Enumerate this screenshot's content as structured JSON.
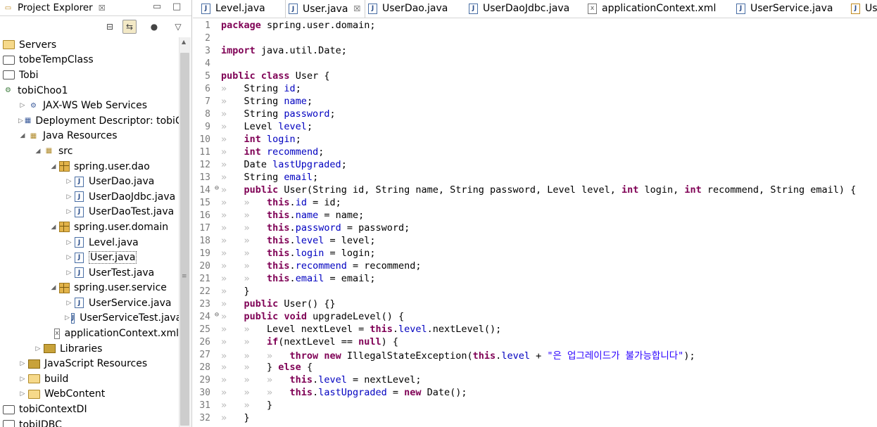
{
  "explorer": {
    "title": "Project Explorer",
    "close_glyph": "☒",
    "minimize_glyph": "▭",
    "maximize_glyph": "□",
    "view_menu_glyph": "▽",
    "items": [
      {
        "depth": 0,
        "twisty": "",
        "icon": "folder-open",
        "label": "Servers"
      },
      {
        "depth": 0,
        "twisty": "",
        "icon": "project",
        "label": "tobeTempClass"
      },
      {
        "depth": 0,
        "twisty": "",
        "icon": "project",
        "label": "Tobi"
      },
      {
        "depth": 0,
        "twisty": "",
        "icon": "web-project",
        "label": "tobiChoo1"
      },
      {
        "depth": 1,
        "twisty": "▷",
        "icon": "web-services",
        "label": "JAX-WS Web Services"
      },
      {
        "depth": 1,
        "twisty": "▷",
        "icon": "descriptor",
        "label": "Deployment Descriptor: tobiCh"
      },
      {
        "depth": 1,
        "twisty": "◢",
        "icon": "java-resources",
        "label": "Java Resources"
      },
      {
        "depth": 2,
        "twisty": "◢",
        "icon": "src-folder",
        "label": "src"
      },
      {
        "depth": 3,
        "twisty": "◢",
        "icon": "package",
        "label": "spring.user.dao"
      },
      {
        "depth": 4,
        "twisty": "▷",
        "icon": "java",
        "label": "UserDao.java"
      },
      {
        "depth": 4,
        "twisty": "▷",
        "icon": "java",
        "label": "UserDaoJdbc.java"
      },
      {
        "depth": 4,
        "twisty": "▷",
        "icon": "java",
        "label": "UserDaoTest.java"
      },
      {
        "depth": 3,
        "twisty": "◢",
        "icon": "package",
        "label": "spring.user.domain"
      },
      {
        "depth": 4,
        "twisty": "▷",
        "icon": "java",
        "label": "Level.java"
      },
      {
        "depth": 4,
        "twisty": "▷",
        "icon": "java",
        "label": "User.java",
        "selected": true
      },
      {
        "depth": 4,
        "twisty": "▷",
        "icon": "java",
        "label": "UserTest.java"
      },
      {
        "depth": 3,
        "twisty": "◢",
        "icon": "package",
        "label": "spring.user.service"
      },
      {
        "depth": 4,
        "twisty": "▷",
        "icon": "java",
        "label": "UserService.java"
      },
      {
        "depth": 4,
        "twisty": "▷",
        "icon": "java",
        "label": "UserServiceTest.java"
      },
      {
        "depth": 3,
        "twisty": "",
        "icon": "xml",
        "label": "applicationContext.xml"
      },
      {
        "depth": 2,
        "twisty": "▷",
        "icon": "library",
        "label": "Libraries"
      },
      {
        "depth": 1,
        "twisty": "▷",
        "icon": "library",
        "label": "JavaScript Resources"
      },
      {
        "depth": 1,
        "twisty": "▷",
        "icon": "folder-open",
        "label": "build"
      },
      {
        "depth": 1,
        "twisty": "▷",
        "icon": "folder-open",
        "label": "WebContent"
      },
      {
        "depth": 0,
        "twisty": "",
        "icon": "project",
        "label": "tobiContextDI"
      },
      {
        "depth": 0,
        "twisty": "",
        "icon": "project",
        "label": "tobiJDBC"
      }
    ]
  },
  "editor": {
    "tabs": [
      {
        "label": "Level.java",
        "icon": "java"
      },
      {
        "label": "User.java",
        "icon": "java",
        "active": true,
        "close": "☒"
      },
      {
        "label": "UserDao.java",
        "icon": "java"
      },
      {
        "label": "UserDaoJdbc.java",
        "icon": "java"
      },
      {
        "label": "applicationContext.xml",
        "icon": "xml"
      },
      {
        "label": "UserService.java",
        "icon": "java"
      },
      {
        "label": "Us",
        "icon": "java-warn"
      }
    ],
    "lines": [
      {
        "n": "1",
        "t": [
          [
            "kw",
            "package"
          ],
          [
            "src",
            " spring.user.domain;"
          ]
        ]
      },
      {
        "n": "2",
        "t": []
      },
      {
        "n": "3",
        "t": [
          [
            "kw",
            "import"
          ],
          [
            "src",
            " java.util.Date;"
          ]
        ]
      },
      {
        "n": "4",
        "t": []
      },
      {
        "n": "5",
        "t": [
          [
            "kw",
            "public"
          ],
          [
            "src",
            " "
          ],
          [
            "kw",
            "class"
          ],
          [
            "src",
            " User {"
          ]
        ]
      },
      {
        "n": "6",
        "t": [
          [
            "ws",
            "»   "
          ],
          [
            "src",
            "String "
          ],
          [
            "fld",
            "id"
          ],
          [
            "src",
            ";"
          ]
        ]
      },
      {
        "n": "7",
        "t": [
          [
            "ws",
            "»   "
          ],
          [
            "src",
            "String "
          ],
          [
            "fld",
            "name"
          ],
          [
            "src",
            ";"
          ]
        ]
      },
      {
        "n": "8",
        "t": [
          [
            "ws",
            "»   "
          ],
          [
            "src",
            "String "
          ],
          [
            "fld",
            "password"
          ],
          [
            "src",
            ";"
          ]
        ]
      },
      {
        "n": "9",
        "t": [
          [
            "ws",
            "»   "
          ],
          [
            "src",
            "Level "
          ],
          [
            "fld",
            "level"
          ],
          [
            "src",
            ";"
          ]
        ]
      },
      {
        "n": "10",
        "t": [
          [
            "ws",
            "»   "
          ],
          [
            "kw",
            "int"
          ],
          [
            "src",
            " "
          ],
          [
            "fld",
            "login"
          ],
          [
            "src",
            ";"
          ]
        ]
      },
      {
        "n": "11",
        "t": [
          [
            "ws",
            "»   "
          ],
          [
            "kw",
            "int"
          ],
          [
            "src",
            " "
          ],
          [
            "fld",
            "recommend"
          ],
          [
            "src",
            ";"
          ]
        ]
      },
      {
        "n": "12",
        "t": [
          [
            "ws",
            "»   "
          ],
          [
            "src",
            "Date "
          ],
          [
            "fld",
            "lastUpgraded"
          ],
          [
            "src",
            ";"
          ]
        ]
      },
      {
        "n": "13",
        "t": [
          [
            "ws",
            "»   "
          ],
          [
            "src",
            "String "
          ],
          [
            "fld",
            "email"
          ],
          [
            "src",
            ";"
          ]
        ]
      },
      {
        "n": "14",
        "fold": "⊖",
        "t": [
          [
            "ws",
            "»   "
          ],
          [
            "kw",
            "public"
          ],
          [
            "src",
            " User(String id, String name, String password, Level level, "
          ],
          [
            "kw",
            "int"
          ],
          [
            "src",
            " login, "
          ],
          [
            "kw",
            "int"
          ],
          [
            "src",
            " recommend, String email) {"
          ]
        ]
      },
      {
        "n": "15",
        "t": [
          [
            "ws",
            "»   »   "
          ],
          [
            "kw",
            "this"
          ],
          [
            "src",
            "."
          ],
          [
            "fld",
            "id"
          ],
          [
            "src",
            " = id;"
          ]
        ]
      },
      {
        "n": "16",
        "t": [
          [
            "ws",
            "»   »   "
          ],
          [
            "kw",
            "this"
          ],
          [
            "src",
            "."
          ],
          [
            "fld",
            "name"
          ],
          [
            "src",
            " = name;"
          ]
        ]
      },
      {
        "n": "17",
        "t": [
          [
            "ws",
            "»   »   "
          ],
          [
            "kw",
            "this"
          ],
          [
            "src",
            "."
          ],
          [
            "fld",
            "password"
          ],
          [
            "src",
            " = password;"
          ]
        ]
      },
      {
        "n": "18",
        "t": [
          [
            "ws",
            "»   »   "
          ],
          [
            "kw",
            "this"
          ],
          [
            "src",
            "."
          ],
          [
            "fld",
            "level"
          ],
          [
            "src",
            " = level;"
          ]
        ]
      },
      {
        "n": "19",
        "t": [
          [
            "ws",
            "»   »   "
          ],
          [
            "kw",
            "this"
          ],
          [
            "src",
            "."
          ],
          [
            "fld",
            "login"
          ],
          [
            "src",
            " = login;"
          ]
        ]
      },
      {
        "n": "20",
        "t": [
          [
            "ws",
            "»   »   "
          ],
          [
            "kw",
            "this"
          ],
          [
            "src",
            "."
          ],
          [
            "fld",
            "recommend"
          ],
          [
            "src",
            " = recommend;"
          ]
        ]
      },
      {
        "n": "21",
        "t": [
          [
            "ws",
            "»   »   "
          ],
          [
            "kw",
            "this"
          ],
          [
            "src",
            "."
          ],
          [
            "fld",
            "email"
          ],
          [
            "src",
            " = email;"
          ]
        ]
      },
      {
        "n": "22",
        "t": [
          [
            "ws",
            "»   "
          ],
          [
            "src",
            "}"
          ]
        ]
      },
      {
        "n": "23",
        "t": [
          [
            "ws",
            "»   "
          ],
          [
            "kw",
            "public"
          ],
          [
            "src",
            " User() {}"
          ]
        ]
      },
      {
        "n": "24",
        "fold": "⊖",
        "t": [
          [
            "ws",
            "»   "
          ],
          [
            "kw",
            "public"
          ],
          [
            "src",
            " "
          ],
          [
            "kw",
            "void"
          ],
          [
            "src",
            " upgradeLevel() {"
          ]
        ]
      },
      {
        "n": "25",
        "t": [
          [
            "ws",
            "»   »   "
          ],
          [
            "src",
            "Level nextLevel = "
          ],
          [
            "kw",
            "this"
          ],
          [
            "src",
            "."
          ],
          [
            "fld",
            "level"
          ],
          [
            "src",
            ".nextLevel();"
          ]
        ]
      },
      {
        "n": "26",
        "t": [
          [
            "ws",
            "»   »   "
          ],
          [
            "kw",
            "if"
          ],
          [
            "src",
            "(nextLevel == "
          ],
          [
            "kw",
            "null"
          ],
          [
            "src",
            ") {"
          ]
        ]
      },
      {
        "n": "27",
        "t": [
          [
            "ws",
            "»   »   »   "
          ],
          [
            "kw",
            "throw"
          ],
          [
            "src",
            " "
          ],
          [
            "kw",
            "new"
          ],
          [
            "src",
            " IllegalStateException("
          ],
          [
            "kw",
            "this"
          ],
          [
            "src",
            "."
          ],
          [
            "fld",
            "level"
          ],
          [
            "src",
            " + "
          ],
          [
            "str",
            "\"은 업그레이드가 불가능합니다\""
          ],
          [
            "src",
            ");"
          ]
        ]
      },
      {
        "n": "28",
        "t": [
          [
            "ws",
            "»   »   "
          ],
          [
            "src",
            "} "
          ],
          [
            "kw",
            "else"
          ],
          [
            "src",
            " {"
          ]
        ]
      },
      {
        "n": "29",
        "t": [
          [
            "ws",
            "»   »   »   "
          ],
          [
            "kw",
            "this"
          ],
          [
            "src",
            "."
          ],
          [
            "fld",
            "level"
          ],
          [
            "src",
            " = nextLevel;"
          ]
        ]
      },
      {
        "n": "30",
        "t": [
          [
            "ws",
            "»   »   »   "
          ],
          [
            "kw",
            "this"
          ],
          [
            "src",
            "."
          ],
          [
            "fld",
            "lastUpgraded"
          ],
          [
            "src",
            " = "
          ],
          [
            "kw",
            "new"
          ],
          [
            "src",
            " Date();"
          ]
        ]
      },
      {
        "n": "31",
        "t": [
          [
            "ws",
            "»   »   "
          ],
          [
            "src",
            "}"
          ]
        ]
      },
      {
        "n": "32",
        "t": [
          [
            "ws",
            "»   "
          ],
          [
            "src",
            "}"
          ]
        ]
      }
    ]
  }
}
